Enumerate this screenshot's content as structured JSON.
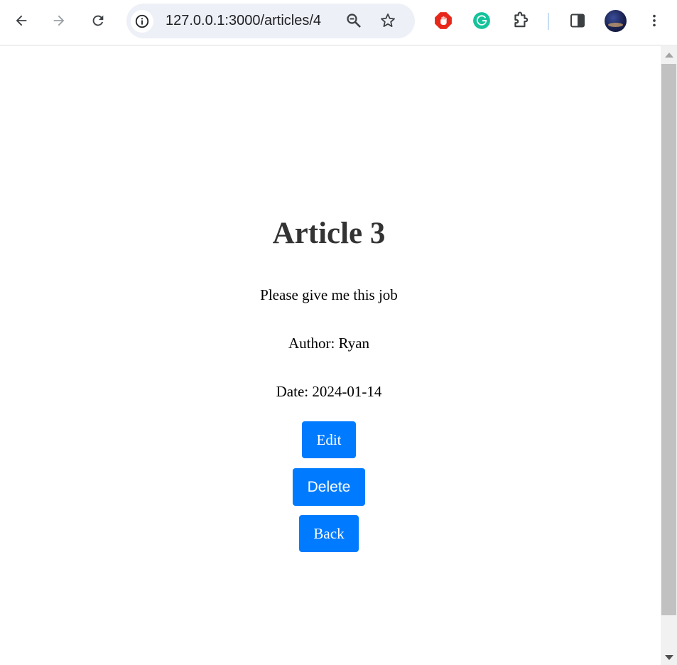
{
  "browser": {
    "url": "127.0.0.1:3000/articles/4",
    "icons": {
      "back": "arrow-left-icon",
      "forward": "arrow-right-icon",
      "reload": "reload-icon",
      "info": "info-icon",
      "zoom": "zoom-out-icon",
      "bookmark": "star-icon",
      "adblock": "stop-hand-icon",
      "grammarly": "grammarly-icon",
      "extensions": "puzzle-icon",
      "side_panel": "side-panel-icon",
      "menu": "kebab-menu-icon"
    },
    "colors": {
      "omnibox_bg": "#edf0f6",
      "adblock_red": "#e8271b",
      "grammarly_green": "#15c39a"
    }
  },
  "article": {
    "title": "Article 3",
    "body": "Please give me this job",
    "author": "Author: Ryan",
    "date": "Date: 2024-01-14"
  },
  "actions": {
    "edit_label": "Edit",
    "delete_label": "Delete",
    "back_label": "Back"
  },
  "theme": {
    "button_blue": "#007bff",
    "title_color": "#333333"
  }
}
